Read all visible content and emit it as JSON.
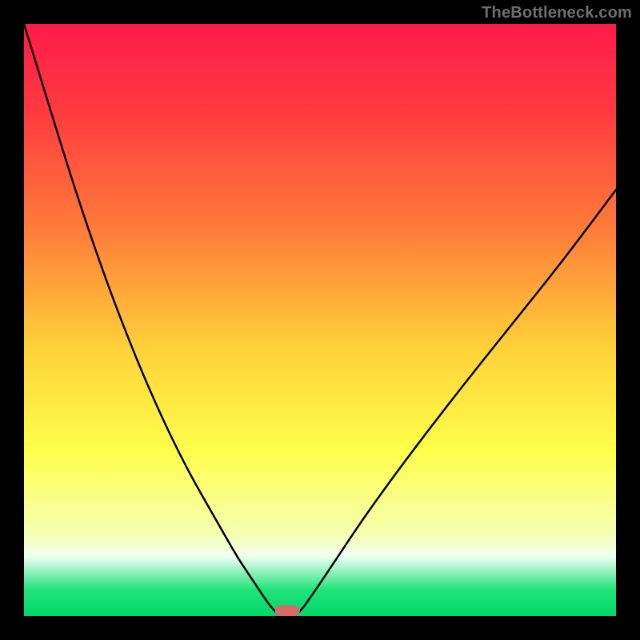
{
  "watermark": "TheBottleneck.com",
  "chart_data": {
    "type": "line",
    "title": "",
    "xlabel": "",
    "ylabel": "",
    "xlim": [
      0,
      100
    ],
    "ylim": [
      0,
      100
    ],
    "gradient_stops": [
      {
        "offset": 0,
        "color": "#ff1a4b"
      },
      {
        "offset": 0.15,
        "color": "#ff3b3f"
      },
      {
        "offset": 0.35,
        "color": "#ff7d3a"
      },
      {
        "offset": 0.55,
        "color": "#ffd23a"
      },
      {
        "offset": 0.72,
        "color": "#ffff4a"
      },
      {
        "offset": 0.86,
        "color": "#f6ffb0"
      },
      {
        "offset": 0.9,
        "color": "#eefff2"
      },
      {
        "offset": 0.955,
        "color": "#22e47a"
      },
      {
        "offset": 1.0,
        "color": "#00d76a"
      }
    ],
    "series": [
      {
        "name": "left-curve",
        "x": [
          0,
          4,
          8,
          12,
          16,
          20,
          24,
          28,
          32,
          36,
          38,
          40,
          41,
          42,
          43
        ],
        "y": [
          100,
          87,
          74,
          62,
          51,
          41,
          32,
          24,
          17,
          10,
          7,
          4,
          2.5,
          1.2,
          0.25
        ]
      },
      {
        "name": "right-curve",
        "x": [
          46,
          47,
          48,
          50,
          53,
          57,
          62,
          68,
          75,
          83,
          91,
          100
        ],
        "y": [
          0.25,
          1.2,
          2.6,
          5.5,
          10,
          16,
          23,
          31,
          40,
          50,
          60,
          72
        ]
      }
    ],
    "marker": {
      "x_center": 44.5,
      "width": 4.2,
      "height": 1.8,
      "color": "#d86a6a",
      "rx": 1.0
    }
  }
}
